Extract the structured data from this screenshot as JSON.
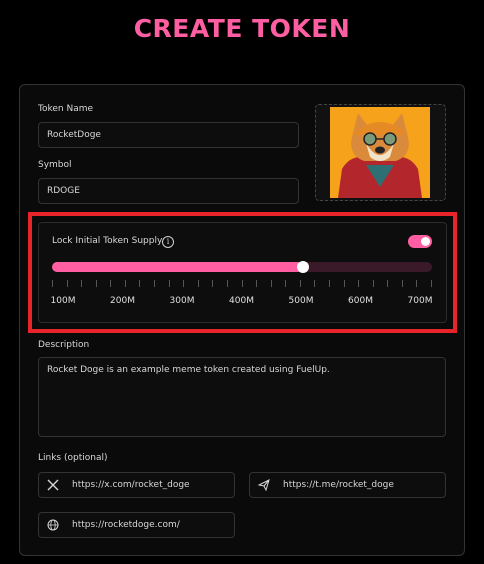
{
  "page": {
    "title": "CREATE TOKEN"
  },
  "form": {
    "token_name": {
      "label": "Token Name",
      "value": "RocketDoge"
    },
    "symbol": {
      "label": "Symbol",
      "value": "RDOGE"
    },
    "supply": {
      "label": "Lock Initial Token Supply",
      "info_icon": "info-icon",
      "toggle_on": true,
      "slider_value_fraction": 0.66,
      "tick_labels": [
        "100M",
        "200M",
        "300M",
        "400M",
        "500M",
        "600M",
        "700M"
      ]
    },
    "description": {
      "label": "Description",
      "value": "Rocket Doge is an example meme token created using FuelUp."
    },
    "links": {
      "label": "Links (optional)",
      "twitter": "https://x.com/rocket_doge",
      "telegram": "https://t.me/rocket_doge",
      "website": "https://rocketdoge.com/"
    }
  },
  "colors": {
    "accent": "#ff5fa2",
    "highlight": "#e8232a",
    "image_bg": "#f6a21b"
  }
}
